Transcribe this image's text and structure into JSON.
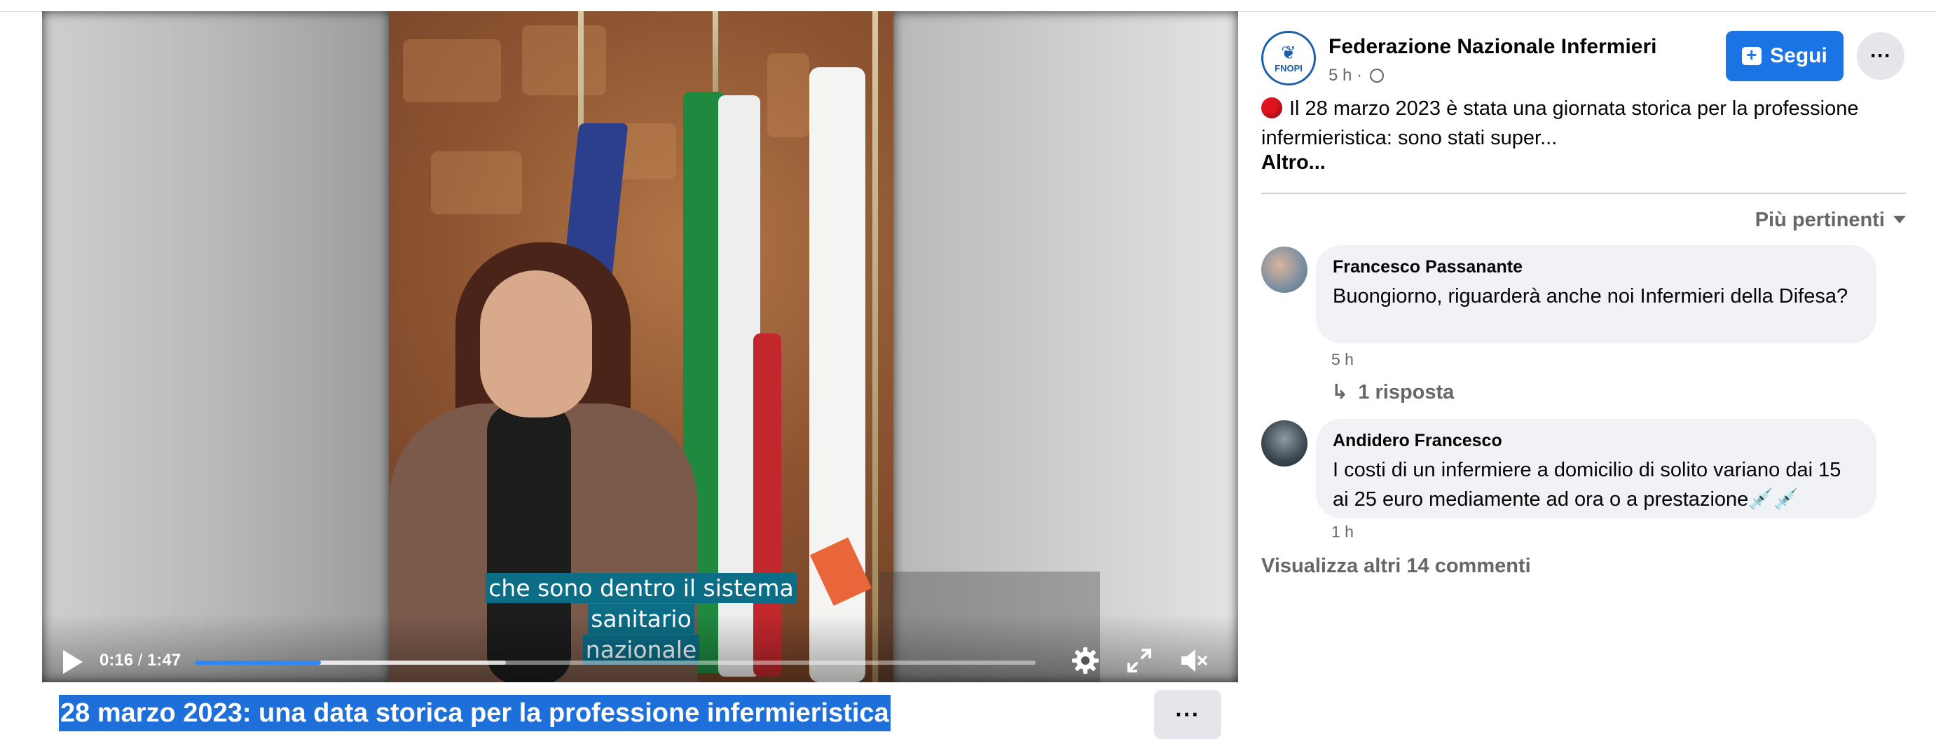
{
  "video": {
    "subtitle_line1": "che sono dentro il sistema sanitario",
    "subtitle_line2": "nazionale",
    "current_time": "0:16",
    "separator": "/",
    "duration": "1:47",
    "played_fraction": 0.15,
    "buffered_fraction": 0.37,
    "colors": {
      "progress": "#2d88ff",
      "subtitle_bg": "#0b6d86"
    },
    "icons": [
      "play-icon",
      "settings-gear-icon",
      "fullscreen-icon",
      "muted-speaker-icon"
    ]
  },
  "title": "28 marzo 2023: una data storica per la professione infermieristica",
  "title_more": "···",
  "post": {
    "page_name": "Federazione Nazionale Infermieri",
    "avatar_label": "FNOPI",
    "time": "5 h",
    "meta_sep": "·",
    "follow_label": "Segui",
    "more_label": "···",
    "text": "Il 28 marzo 2023 è stata una giornata storica per la professione infermieristica: sono stati super...",
    "see_more": "Altro...",
    "accent": "#1b74e4"
  },
  "comments_section": {
    "sort_label": "Più pertinenti",
    "comments": [
      {
        "author": "Francesco Passanante",
        "text": "Buongiorno, riguarderà anche noi Infermieri della Difesa?",
        "time": "5 h",
        "replies": "1 risposta"
      },
      {
        "author": "Andidero Francesco",
        "text": "I costi di un infermiere a domicilio di solito variano dai 15 ai 25 euro mediamente ad ora o a prestazione💉💉",
        "time": "1 h"
      }
    ],
    "view_more": "Visualizza altri 14 commenti"
  }
}
